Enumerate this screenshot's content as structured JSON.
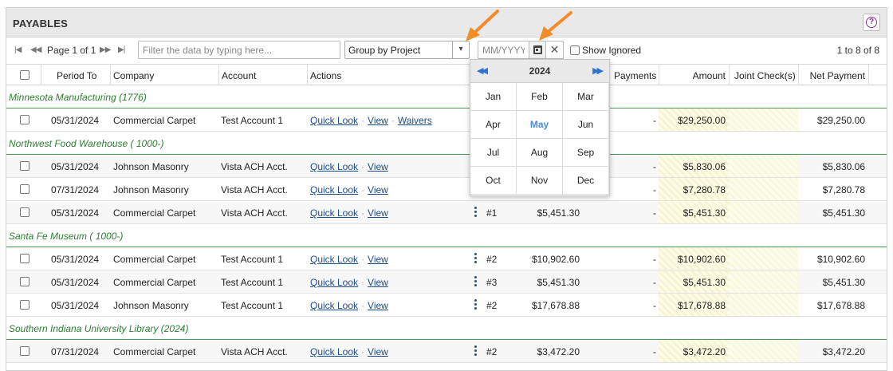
{
  "panel": {
    "title": "PAYABLES",
    "help_icon": "question-circle-icon",
    "help_glyph": "?"
  },
  "toolbar": {
    "page_info": "Page 1 of 1",
    "filter_placeholder": "Filter the data by typing here...",
    "group_by": "Group by Project",
    "date_placeholder": "MM/YYYY",
    "clear_glyph": "✕",
    "show_ignored_label": "Show Ignored",
    "record_count": "1 to 8 of 8"
  },
  "columns": {
    "period_to": "Period To",
    "company": "Company",
    "account": "Account",
    "actions": "Actions",
    "payments": "Payments",
    "amount": "Amount",
    "joint_checks": "Joint Check(s)",
    "net_payment": "Net Payment"
  },
  "groups": [
    "Minnesota Manufacturing (1776)",
    "Northwest Food Warehouse ( 1000-)",
    "Santa Fe Museum ( 1000-)",
    "Southern Indiana University Library (2024)"
  ],
  "rows": [
    {
      "period": "05/31/2024",
      "company": "Commercial Carpet",
      "account": "Test Account 1",
      "actions": [
        "Quick Look",
        "View",
        "Waivers"
      ],
      "num": "",
      "payment_amt": "",
      "payments": "-",
      "amount": "$29,250.00",
      "net": "$29,250.00"
    },
    {
      "period": "05/31/2024",
      "company": "Johnson Masonry",
      "account": "Vista ACH Acct.",
      "actions": [
        "Quick Look",
        "View"
      ],
      "num": "",
      "payment_amt": "",
      "payments": "-",
      "amount": "$5,830.06",
      "net": "$5,830.06"
    },
    {
      "period": "07/31/2024",
      "company": "Johnson Masonry",
      "account": "Vista ACH Acct.",
      "actions": [
        "Quick Look",
        "View"
      ],
      "num": "",
      "payment_amt": "",
      "payments": "-",
      "amount": "$7,280.78",
      "net": "$7,280.78"
    },
    {
      "period": "05/31/2024",
      "company": "Commercial Carpet",
      "account": "Vista ACH Acct.",
      "actions": [
        "Quick Look",
        "View"
      ],
      "num": "#1",
      "payment_amt": "$5,451.30",
      "payments": "-",
      "amount": "$5,451.30",
      "net": "$5,451.30"
    },
    {
      "period": "05/31/2024",
      "company": "Commercial Carpet",
      "account": "Test Account 1",
      "actions": [
        "Quick Look",
        "View"
      ],
      "num": "#2",
      "payment_amt": "$10,902.60",
      "payments": "-",
      "amount": "$10,902.60",
      "net": "$10,902.60"
    },
    {
      "period": "05/31/2024",
      "company": "Commercial Carpet",
      "account": "Test Account 1",
      "actions": [
        "Quick Look",
        "View"
      ],
      "num": "#3",
      "payment_amt": "$5,451.30",
      "payments": "-",
      "amount": "$5,451.30",
      "net": "$5,451.30"
    },
    {
      "period": "05/31/2024",
      "company": "Johnson Masonry",
      "account": "Test Account 1",
      "actions": [
        "Quick Look",
        "View"
      ],
      "num": "#2",
      "payment_amt": "$17,678.88",
      "payments": "-",
      "amount": "$17,678.88",
      "net": "$17,678.88"
    },
    {
      "period": "07/31/2024",
      "company": "Commercial Carpet",
      "account": "Vista ACH Acct.",
      "actions": [
        "Quick Look",
        "View"
      ],
      "num": "#2",
      "payment_amt": "$3,472.20",
      "payments": "-",
      "amount": "$3,472.20",
      "net": "$3,472.20"
    }
  ],
  "month_picker": {
    "year": "2024",
    "selected": "May",
    "months": [
      "Jan",
      "Feb",
      "Mar",
      "Apr",
      "May",
      "Jun",
      "Jul",
      "Aug",
      "Sep",
      "Oct",
      "Nov",
      "Dec"
    ]
  },
  "colors": {
    "accent_arrow": "#f28c28",
    "group_text": "#2e7d32",
    "link": "#1e4c8a",
    "selected_month": "#4a8be0"
  }
}
